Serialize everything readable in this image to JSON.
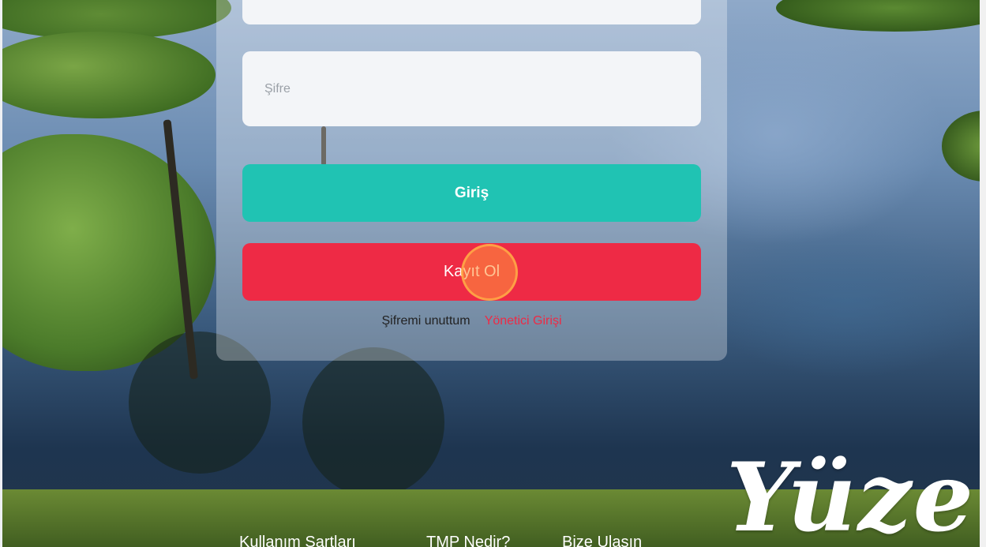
{
  "form": {
    "username_placeholder": "",
    "password_placeholder": "Şifre",
    "login_label": "Giriş",
    "register_label": "Kayıt Ol"
  },
  "links": {
    "forgot_password": "Şifremi unuttum",
    "admin_login": "Yönetici Girişi"
  },
  "footer": {
    "terms": "Kullanım Şartları",
    "about": "TMP Nedir?",
    "contact": "Bize Ulaşın"
  },
  "branding": {
    "logo_text": "Yüze"
  },
  "colors": {
    "login_button": "#20c3b3",
    "register_button": "#ee2a45",
    "admin_link": "#ee2a45"
  }
}
